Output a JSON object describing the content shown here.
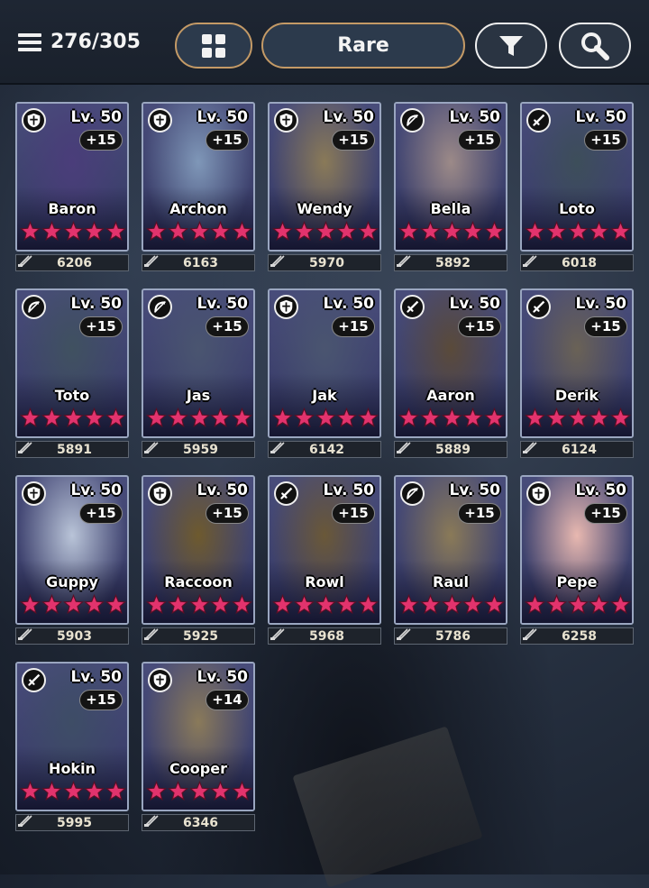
{
  "header": {
    "count": "276/305",
    "rarity_label": "Rare"
  },
  "icons": {
    "menu": "menu-icon",
    "grid": "grid-icon",
    "filter": "funnel-icon",
    "search": "magnifier-icon",
    "classes": {
      "shield": "shield-icon",
      "bow": "bow-icon",
      "sword": "sword-icon"
    }
  },
  "colors": {
    "accent_border": "#c49a66",
    "star": "#e2336d",
    "card_border": "#9aa6c0"
  },
  "heroes": [
    {
      "name": "Baron",
      "level": "Lv. 50",
      "plus": "+15",
      "stars": 5,
      "power": "6206",
      "class": "shield",
      "art": "#4a3d7a"
    },
    {
      "name": "Archon",
      "level": "Lv. 50",
      "plus": "+15",
      "stars": 5,
      "power": "6163",
      "class": "shield",
      "art": "#7f97b8"
    },
    {
      "name": "Wendy",
      "level": "Lv. 50",
      "plus": "+15",
      "stars": 5,
      "power": "5970",
      "class": "shield",
      "art": "#8a7a58"
    },
    {
      "name": "Bella",
      "level": "Lv. 50",
      "plus": "+15",
      "stars": 5,
      "power": "5892",
      "class": "bow",
      "art": "#9c8a88"
    },
    {
      "name": "Loto",
      "level": "Lv. 50",
      "plus": "+15",
      "stars": 5,
      "power": "6018",
      "class": "sword",
      "art": "#3d4e5a"
    },
    {
      "name": "Toto",
      "level": "Lv. 50",
      "plus": "+15",
      "stars": 5,
      "power": "5891",
      "class": "bow",
      "art": "#405160"
    },
    {
      "name": "Jas",
      "level": "Lv. 50",
      "plus": "+15",
      "stars": 5,
      "power": "5959",
      "class": "bow",
      "art": "#4a5570"
    },
    {
      "name": "Jak",
      "level": "Lv. 50",
      "plus": "+15",
      "stars": 5,
      "power": "6142",
      "class": "shield",
      "art": "#4a5570"
    },
    {
      "name": "Aaron",
      "level": "Lv. 50",
      "plus": "+15",
      "stars": 5,
      "power": "5889",
      "class": "sword",
      "art": "#5a4a3a"
    },
    {
      "name": "Derik",
      "level": "Lv. 50",
      "plus": "+15",
      "stars": 5,
      "power": "6124",
      "class": "sword",
      "art": "#6a6256"
    },
    {
      "name": "Guppy",
      "level": "Lv. 50",
      "plus": "+15",
      "stars": 5,
      "power": "5903",
      "class": "shield",
      "art": "#b9c4d8"
    },
    {
      "name": "Raccoon",
      "level": "Lv. 50",
      "plus": "+15",
      "stars": 5,
      "power": "5925",
      "class": "shield",
      "art": "#6e5a2e"
    },
    {
      "name": "Rowl",
      "level": "Lv. 50",
      "plus": "+15",
      "stars": 5,
      "power": "5968",
      "class": "sword",
      "art": "#6a5838"
    },
    {
      "name": "Raul",
      "level": "Lv. 50",
      "plus": "+15",
      "stars": 5,
      "power": "5786",
      "class": "bow",
      "art": "#8a7a58"
    },
    {
      "name": "Pepe",
      "level": "Lv. 50",
      "plus": "+15",
      "stars": 5,
      "power": "6258",
      "class": "shield",
      "art": "#e8b8b0"
    },
    {
      "name": "Hokin",
      "level": "Lv. 50",
      "plus": "+15",
      "stars": 5,
      "power": "5995",
      "class": "sword",
      "art": "#3e4d66"
    },
    {
      "name": "Cooper",
      "level": "Lv. 50",
      "plus": "+14",
      "stars": 5,
      "power": "6346",
      "class": "shield",
      "art": "#8a7a5a"
    }
  ]
}
